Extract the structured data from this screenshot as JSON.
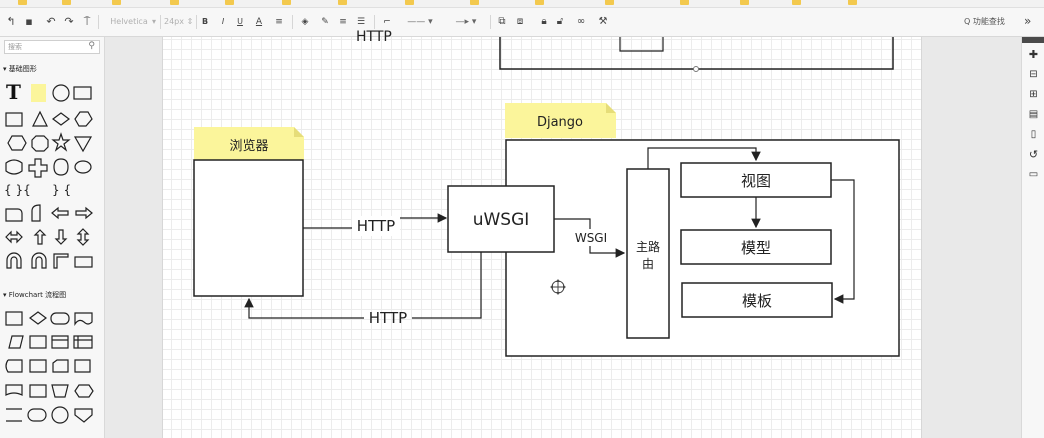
{
  "toolbar": {
    "font_name": "Helvetica",
    "font_size": "24px"
  },
  "search": {
    "placeholder": "搜索"
  },
  "find_label": "Q 功能查找",
  "sections": {
    "basic": "▾ 基础图形",
    "flowchart": "▾ Flowchart 流程图"
  },
  "diagram": {
    "top_label_partial": "HTTP",
    "browser_note": "浏览器",
    "django_note": "Django",
    "uwsgi": "uWSGI",
    "http_forward": "HTTP",
    "http_back": "HTTP",
    "wsgi": "WSGI",
    "router_line1": "主路",
    "router_line2": "由",
    "view": "视图",
    "model": "模型",
    "template": "模板"
  },
  "colors": {
    "note_fill": "#fbf59b",
    "note_fold": "#e6dd79",
    "canvas": "#e9e9e9",
    "grid": "#ececec"
  }
}
